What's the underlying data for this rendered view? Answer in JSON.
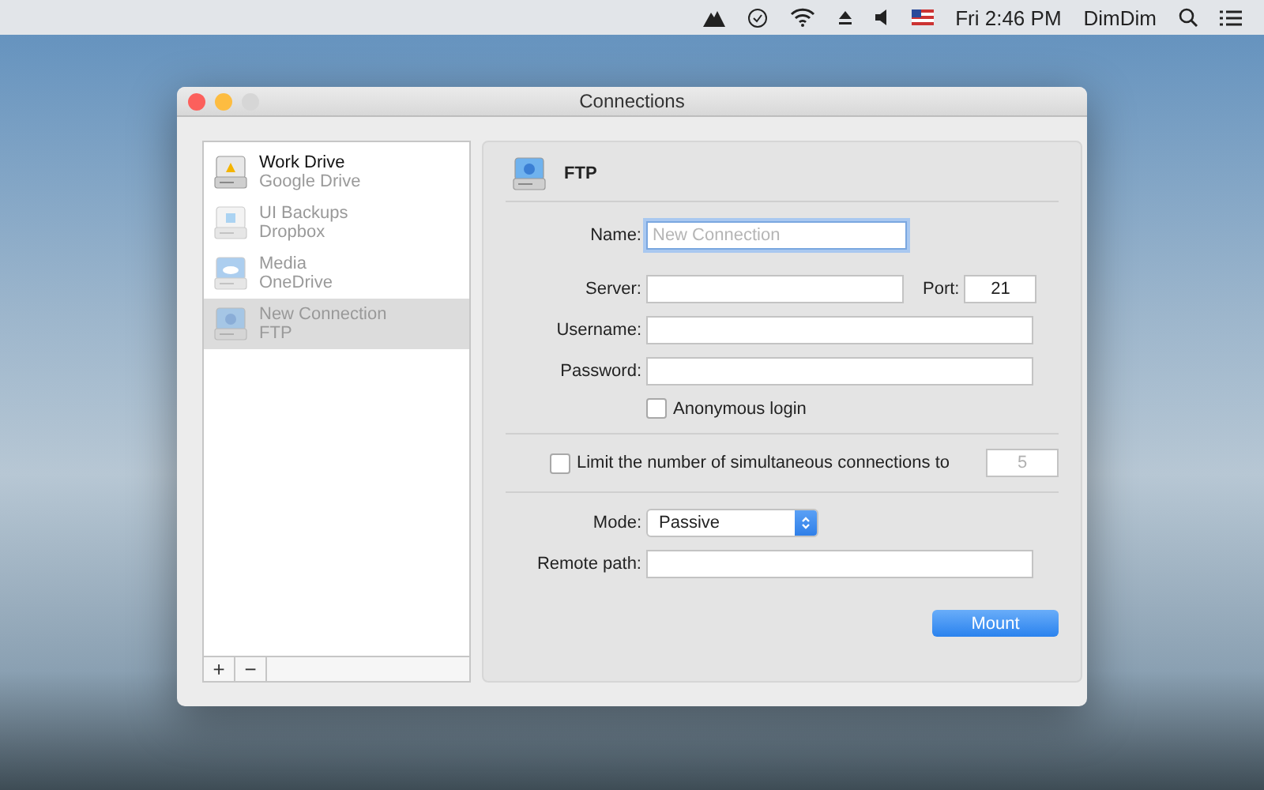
{
  "menu_bar": {
    "clock": "Fri 2:46 PM",
    "user": "DimDim"
  },
  "window": {
    "title": "Connections"
  },
  "sidebar": {
    "items": [
      {
        "name": "Work Drive",
        "service": "Google Drive",
        "kind": "gdrive",
        "active": true,
        "selected": false
      },
      {
        "name": "UI Backups",
        "service": "Dropbox",
        "kind": "dropbox",
        "active": false,
        "selected": false
      },
      {
        "name": "Media",
        "service": "OneDrive",
        "kind": "onedrive",
        "active": false,
        "selected": false
      },
      {
        "name": "New Connection",
        "service": "FTP",
        "kind": "ftp",
        "active": false,
        "selected": true
      }
    ],
    "add": "+",
    "remove": "−"
  },
  "form": {
    "header": "FTP",
    "name": {
      "label": "Name:",
      "placeholder": "New Connection",
      "focused": true
    },
    "server": {
      "label": "Server:"
    },
    "port": {
      "label": "Port:",
      "value": "21"
    },
    "username": {
      "label": "Username:"
    },
    "password": {
      "label": "Password:"
    },
    "anonymous": {
      "label": "Anonymous login",
      "checked": false
    },
    "limit": {
      "label": "Limit the number of simultaneous connections to",
      "checked": false,
      "placeholder": "5"
    },
    "mode": {
      "label": "Mode:",
      "value": "Passive"
    },
    "remote_path": {
      "label": "Remote path:"
    },
    "mount": "Mount"
  }
}
